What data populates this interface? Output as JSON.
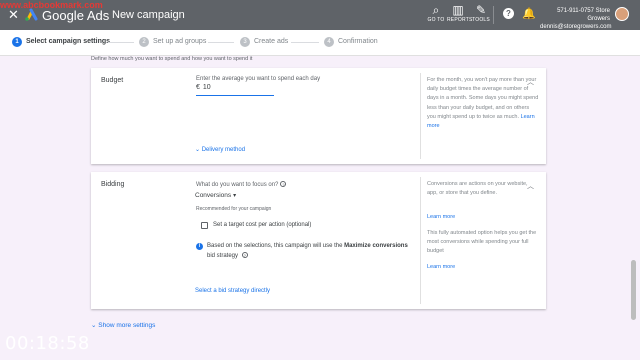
{
  "watermark": "www.abcbookmark.com",
  "topbar": {
    "close_icon": "close-icon",
    "app_name": "Google Ads",
    "crumb": "New campaign",
    "goto_label": "GO TO",
    "reports_label": "REPORTS",
    "tools_label": "TOOLS",
    "account_phone": "571-911-0757 Store Growers",
    "account_email": "dennis@storegrowers.com"
  },
  "steps": [
    {
      "num": "1",
      "label": "Select campaign settings"
    },
    {
      "num": "2",
      "label": "Set up ad groups"
    },
    {
      "num": "3",
      "label": "Create ads"
    },
    {
      "num": "4",
      "label": "Confirmation"
    }
  ],
  "intro": "Define how much you want to spend and how you want to spend it",
  "budget": {
    "title": "Budget",
    "field_label": "Enter the average you want to spend each day",
    "currency": "€",
    "value": "10",
    "delivery_link": "Delivery method",
    "side_text": "For the month, you won't pay more than your daily budget times the average number of days in a month. Some days you might spend less than your daily budget, and on others you might spend up to twice as much.",
    "learn_more": "Learn more"
  },
  "bidding": {
    "title": "Bidding",
    "question": "What do you want to focus on?",
    "selected": "Conversions",
    "recommended": "Recommended for your campaign",
    "checkbox_label": "Set a target cost per action (optional)",
    "info_prefix": "Based on the selections, this campaign will use the",
    "info_bold": "Maximize conversions",
    "info_suffix": "bid strategy",
    "select_link": "Select a bid strategy directly",
    "side_text_1": "Conversions are actions on your website, app, or store that you define.",
    "learn_more_1": "Learn more",
    "side_text_2": "This fully automated option helps you get the most conversions while spending your full budget",
    "learn_more_2": "Learn more"
  },
  "show_more": "Show more settings",
  "timer": "00:18:58"
}
